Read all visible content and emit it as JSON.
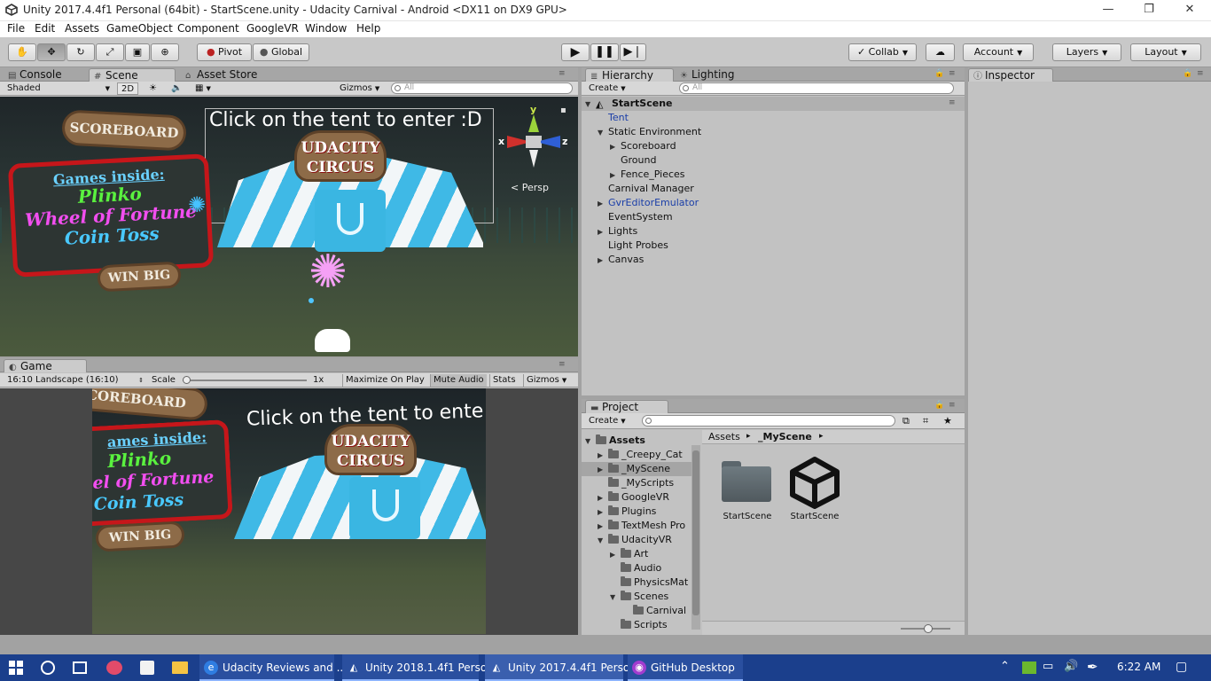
{
  "window": {
    "title": "Unity 2017.4.4f1 Personal (64bit) - StartScene.unity - Udacity Carnival - Android <DX11 on DX9 GPU>",
    "minimize": "—",
    "maximize": "❐",
    "close": "✕"
  },
  "menu": [
    "File",
    "Edit",
    "Assets",
    "GameObject",
    "Component",
    "GoogleVR",
    "Window",
    "Help"
  ],
  "toolbar": {
    "pivot": "Pivot",
    "global": "Global",
    "collab": "Collab",
    "account": "Account",
    "layers": "Layers",
    "layout": "Layout"
  },
  "tabs": {
    "console": "Console",
    "scene": "Scene",
    "asset_store": "Asset Store",
    "hierarchy": "Hierarchy",
    "lighting": "Lighting",
    "inspector": "Inspector",
    "game": "Game",
    "project": "Project"
  },
  "scene_bar": {
    "shading": "Shaded",
    "mode_2d": "2D",
    "gizmos": "Gizmos",
    "search_placeholder": "All"
  },
  "scene_view": {
    "tent_prompt": "Click on the tent to enter :D",
    "scoreboard": "SCOREBOARD",
    "games_inside": "Games inside:",
    "game1": "Plinko",
    "game2": "Wheel of Fortune",
    "game3": "Coin Toss",
    "win_big": "WIN BIG",
    "circus_line1": "UDACITY",
    "circus_line2": "CIRCUS",
    "gizmo_y": "y",
    "gizmo_x": "x",
    "gizmo_z": "z",
    "persp": "Persp"
  },
  "game_bar": {
    "aspect": "16:10 Landscape (16:10)",
    "scale_label": "Scale",
    "scale_value": "1x",
    "maximize_on_play": "Maximize On Play",
    "mute_audio": "Mute Audio",
    "stats": "Stats",
    "gizmos": "Gizmos",
    "scale_level": 0.0
  },
  "game_view": {
    "tent_prompt": "Click on the tent to ente",
    "scoreboard": "COREBOARD",
    "games_inside": "ames inside:",
    "game1": "Plinko",
    "game2": "el of Fortune",
    "game3": "Coin Toss",
    "win_big": "WIN BIG",
    "circus_line1": "UDACITY",
    "circus_line2": "CIRCUS"
  },
  "hierarchy": {
    "create": "Create",
    "search_placeholder": "All",
    "scene": "StartScene",
    "items": [
      {
        "label": "Tent",
        "indent": 0,
        "arrow": "",
        "color": "blue"
      },
      {
        "label": "Static Environment",
        "indent": 0,
        "arrow": "down",
        "color": ""
      },
      {
        "label": "Scoreboard",
        "indent": 1,
        "arrow": "right",
        "color": ""
      },
      {
        "label": "Ground",
        "indent": 1,
        "arrow": "",
        "color": ""
      },
      {
        "label": "Fence_Pieces",
        "indent": 1,
        "arrow": "right",
        "color": ""
      },
      {
        "label": "Carnival Manager",
        "indent": 0,
        "arrow": "",
        "color": ""
      },
      {
        "label": "GvrEditorEmulator",
        "indent": 0,
        "arrow": "right",
        "color": "blue"
      },
      {
        "label": "EventSystem",
        "indent": 0,
        "arrow": "",
        "color": ""
      },
      {
        "label": "Lights",
        "indent": 0,
        "arrow": "right",
        "color": ""
      },
      {
        "label": "Light Probes",
        "indent": 0,
        "arrow": "",
        "color": ""
      },
      {
        "label": "Canvas",
        "indent": 0,
        "arrow": "right",
        "color": ""
      }
    ]
  },
  "project": {
    "create": "Create",
    "breadcrumb_root": "Assets",
    "breadcrumb_sep": "▸",
    "breadcrumb_current": "_MyScene",
    "tree": [
      {
        "label": "Assets",
        "indent": 0,
        "arrow": "down",
        "bold": true
      },
      {
        "label": "_Creepy_Cat",
        "indent": 1,
        "arrow": "right",
        "bold": false
      },
      {
        "label": "_MyScene",
        "indent": 1,
        "arrow": "right",
        "bold": false,
        "selected": true
      },
      {
        "label": "_MyScripts",
        "indent": 1,
        "arrow": "",
        "bold": false
      },
      {
        "label": "GoogleVR",
        "indent": 1,
        "arrow": "right",
        "bold": false
      },
      {
        "label": "Plugins",
        "indent": 1,
        "arrow": "right",
        "bold": false
      },
      {
        "label": "TextMesh Pro",
        "indent": 1,
        "arrow": "right",
        "bold": false
      },
      {
        "label": "UdacityVR",
        "indent": 1,
        "arrow": "down",
        "bold": false
      },
      {
        "label": "Art",
        "indent": 2,
        "arrow": "right",
        "bold": false
      },
      {
        "label": "Audio",
        "indent": 2,
        "arrow": "",
        "bold": false
      },
      {
        "label": "PhysicsMat",
        "indent": 2,
        "arrow": "",
        "bold": false
      },
      {
        "label": "Scenes",
        "indent": 2,
        "arrow": "down",
        "bold": false
      },
      {
        "label": "Carnival",
        "indent": 3,
        "arrow": "",
        "bold": false
      },
      {
        "label": "Scripts",
        "indent": 2,
        "arrow": "",
        "bold": false
      }
    ],
    "assets": [
      {
        "label": "StartScene",
        "type": "folder"
      },
      {
        "label": "StartScene",
        "type": "unity-scene"
      }
    ]
  },
  "taskbar": {
    "items": [
      {
        "label": "Udacity Reviews and ...",
        "icon": "edge-icon"
      },
      {
        "label": "Unity 2018.1.4f1 Perso...",
        "icon": "unity-icon"
      },
      {
        "label": "Unity 2017.4.4f1 Perso...",
        "icon": "unity-icon"
      },
      {
        "label": "GitHub Desktop",
        "icon": "github-icon"
      }
    ],
    "clock": "6:22 AM"
  },
  "colors": {
    "unity_panel": "#c2c2c2",
    "toolbar": "#c8c8c8",
    "taskbar": "#1b3f8c",
    "selection": "#3e7de7",
    "blue_text": "#1a3ea8"
  }
}
